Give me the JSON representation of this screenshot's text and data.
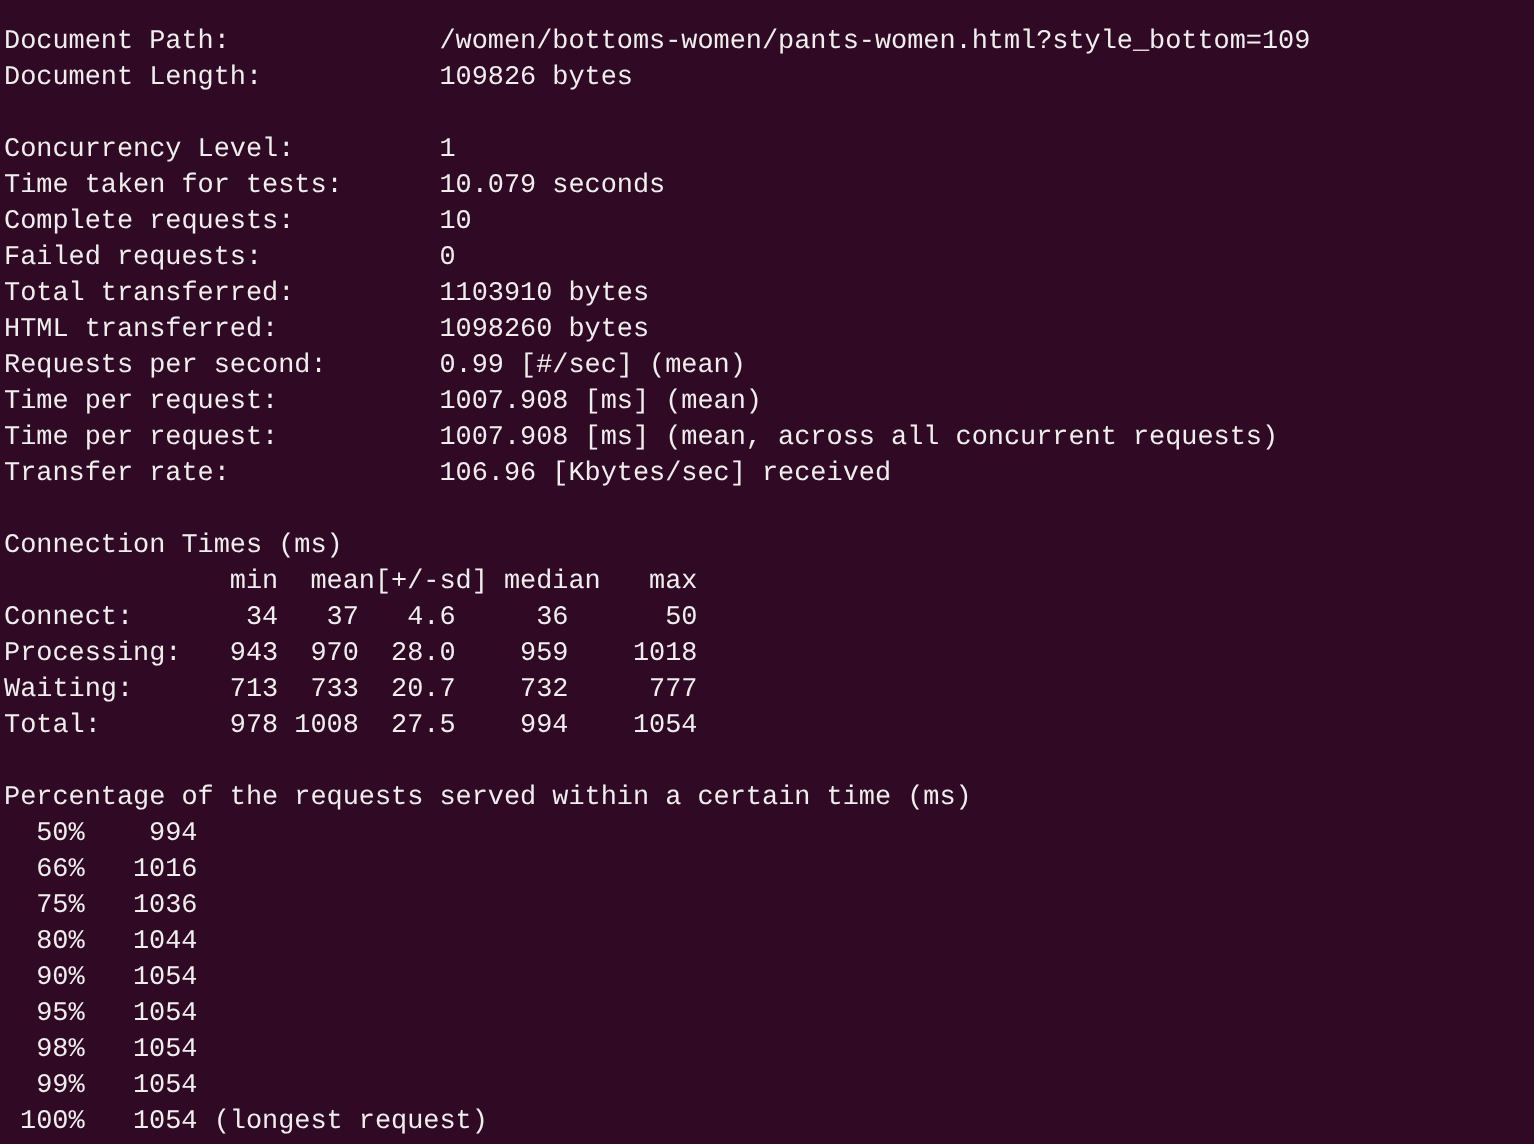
{
  "document": [
    {
      "label": "Document Path:",
      "value": "/women/bottoms-women/pants-women.html?style_bottom=109"
    },
    {
      "label": "Document Length:",
      "value": "109826 bytes"
    }
  ],
  "summary": [
    {
      "label": "Concurrency Level:",
      "value": "1"
    },
    {
      "label": "Time taken for tests:",
      "value": "10.079 seconds"
    },
    {
      "label": "Complete requests:",
      "value": "10"
    },
    {
      "label": "Failed requests:",
      "value": "0"
    },
    {
      "label": "Total transferred:",
      "value": "1103910 bytes"
    },
    {
      "label": "HTML transferred:",
      "value": "1098260 bytes"
    },
    {
      "label": "Requests per second:",
      "value": "0.99 [#/sec] (mean)"
    },
    {
      "label": "Time per request:",
      "value": "1007.908 [ms] (mean)"
    },
    {
      "label": "Time per request:",
      "value": "1007.908 [ms] (mean, across all concurrent requests)"
    },
    {
      "label": "Transfer rate:",
      "value": "106.96 [Kbytes/sec] received"
    }
  ],
  "connection_times": {
    "title": "Connection Times (ms)",
    "columns": [
      "min",
      "mean",
      "[+/-sd]",
      "median",
      "max"
    ],
    "rows": [
      {
        "label": "Connect:",
        "cells": [
          "34",
          "37",
          "4.6",
          "36",
          "50"
        ]
      },
      {
        "label": "Processing:",
        "cells": [
          "943",
          "970",
          "28.0",
          "959",
          "1018"
        ]
      },
      {
        "label": "Waiting:",
        "cells": [
          "713",
          "733",
          "20.7",
          "732",
          "777"
        ]
      },
      {
        "label": "Total:",
        "cells": [
          "978",
          "1008",
          "27.5",
          "994",
          "1054"
        ]
      }
    ]
  },
  "percentiles": {
    "title": "Percentage of the requests served within a certain time (ms)",
    "rows": [
      {
        "percent": "50%",
        "time": "994"
      },
      {
        "percent": "66%",
        "time": "1016"
      },
      {
        "percent": "75%",
        "time": "1036"
      },
      {
        "percent": "80%",
        "time": "1044"
      },
      {
        "percent": "90%",
        "time": "1054"
      },
      {
        "percent": "95%",
        "time": "1054"
      },
      {
        "percent": "98%",
        "time": "1054"
      },
      {
        "percent": "99%",
        "time": "1054"
      },
      {
        "percent": "100%",
        "time": "1054",
        "note": "(longest request)"
      }
    ]
  }
}
